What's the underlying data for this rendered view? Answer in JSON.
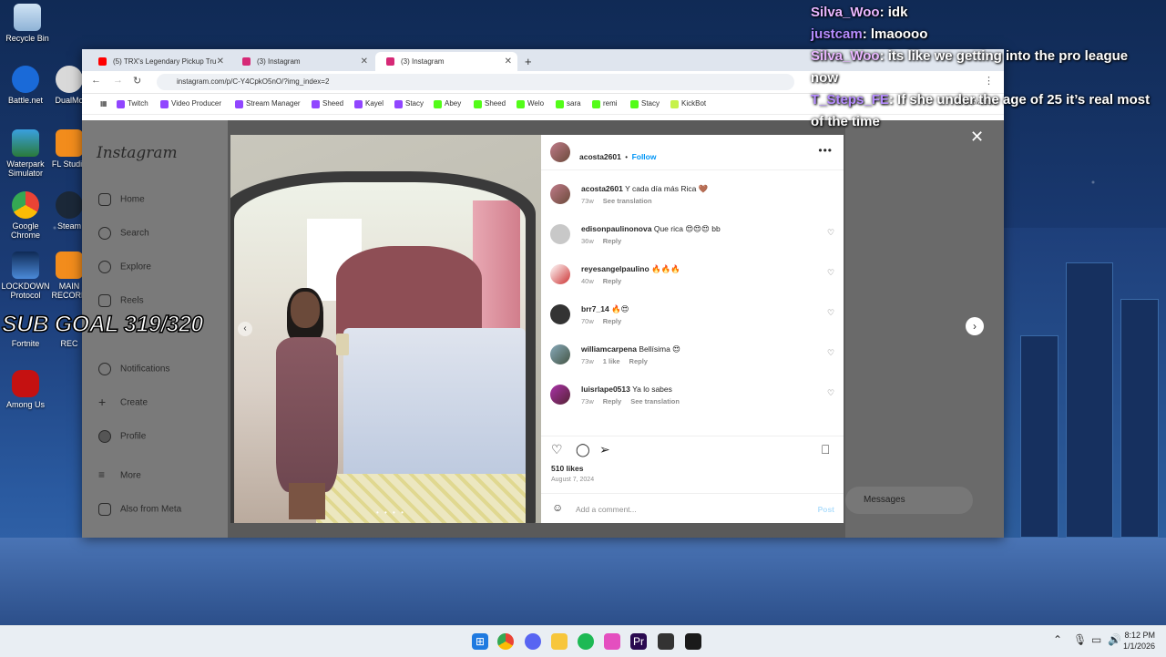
{
  "desktop": {
    "icons": [
      {
        "label": "Recycle Bin"
      },
      {
        "label": "Battle.net"
      },
      {
        "label": "DualMo"
      },
      {
        "label": "Waterpark Simulator"
      },
      {
        "label": "FL Studio"
      },
      {
        "label": "Google Chrome"
      },
      {
        "label": "Steam"
      },
      {
        "label": "LOCKDOWN Protocol"
      },
      {
        "label": "MAIN RECORD"
      },
      {
        "label": "Fortnite"
      },
      {
        "label": "REC"
      },
      {
        "label": "Among Us"
      }
    ],
    "sub_goal": "SUB GOAL 319/320"
  },
  "chat": [
    {
      "user": "Silva_Woo",
      "message": "idk"
    },
    {
      "user": "justcam",
      "message": "lmaoooo"
    },
    {
      "user": "Silva_Woo",
      "message": "its like we getting into the pro league now"
    },
    {
      "user": "T_Steps_FE",
      "message": "If she under the age of 25 it’s real most of the time"
    }
  ],
  "browser": {
    "tabs": [
      {
        "title": "(5) TRX's Legendary Pickup Tru",
        "color": "#ff0000"
      },
      {
        "title": "(3) Instagram",
        "color": "#d62976"
      },
      {
        "title": "(3) Instagram",
        "color": "#d62976"
      }
    ],
    "url": "instagram.com/p/C-Y4CpkO5nO/?img_index=2",
    "bookmarks": [
      {
        "label": "Twitch",
        "color": "#9146ff"
      },
      {
        "label": "Video Producer",
        "color": "#9146ff"
      },
      {
        "label": "Stream Manager",
        "color": "#9146ff"
      },
      {
        "label": "Sheed",
        "color": "#9146ff"
      },
      {
        "label": "Kayel",
        "color": "#9146ff"
      },
      {
        "label": "Stacy",
        "color": "#9146ff"
      },
      {
        "label": "Abey",
        "color": "#53fc18"
      },
      {
        "label": "Sheed",
        "color": "#53fc18"
      },
      {
        "label": "Welo",
        "color": "#53fc18"
      },
      {
        "label": "sara",
        "color": "#53fc18"
      },
      {
        "label": "remi",
        "color": "#53fc18"
      },
      {
        "label": "Stacy",
        "color": "#53fc18"
      },
      {
        "label": "KickBot",
        "color": "#c6f24b"
      }
    ],
    "all_bookmarks": "All Bookmarks"
  },
  "instagram": {
    "logo": "Instagram",
    "nav": [
      "Home",
      "Search",
      "Explore",
      "Reels",
      "Messages",
      "Notifications",
      "Create",
      "Profile",
      "More",
      "Also from Meta"
    ],
    "post": {
      "username": "acosta2601",
      "follow": "Follow",
      "caption_user": "acosta2601",
      "caption": "Y cada día más Rica 🤎",
      "caption_time": "73w",
      "see_translation": "See translation",
      "comments": [
        {
          "user": "edisonpaulinonova",
          "text": "Que rica 😍😍😍 bb",
          "time": "36w",
          "likes": "",
          "reply": "Reply",
          "extra": ""
        },
        {
          "user": "reyesangelpaulino",
          "text": "🔥🔥🔥",
          "time": "40w",
          "likes": "",
          "reply": "Reply",
          "extra": ""
        },
        {
          "user": "brr7_14",
          "text": "🔥😍",
          "time": "70w",
          "likes": "",
          "reply": "Reply",
          "extra": ""
        },
        {
          "user": "williamcarpena",
          "text": "Bellísima 😍",
          "time": "73w",
          "likes": "1 like",
          "reply": "Reply",
          "extra": ""
        },
        {
          "user": "luisrlape0513",
          "text": "Ya lo sabes",
          "time": "73w",
          "likes": "",
          "reply": "Reply",
          "extra": "See translation"
        }
      ],
      "likes": "510 likes",
      "date": "August 7, 2024",
      "add_comment": "Add a comment...",
      "post_label": "Post"
    },
    "messages_label": "Messages"
  },
  "taskbar": {
    "time": "8:12 PM",
    "date": "1/1/2026"
  }
}
